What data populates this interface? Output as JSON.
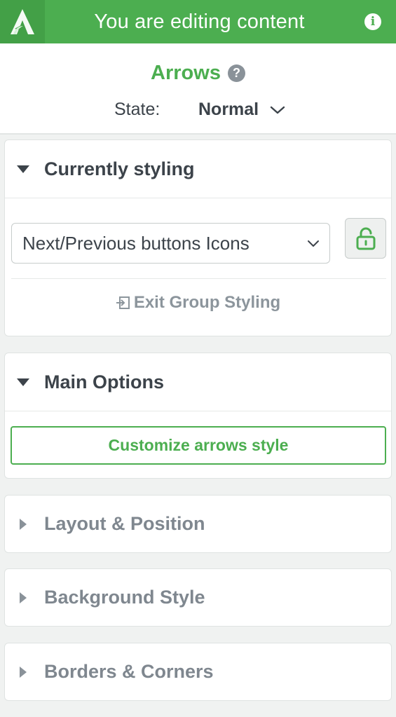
{
  "topbar": {
    "title": "You are editing content",
    "info_glyph": "i",
    "logo": "oxygen-logo-icon",
    "color": "#4cae50"
  },
  "header": {
    "element_title": "Arrows",
    "help_glyph": "?",
    "state_label": "State:",
    "state_value": "Normal"
  },
  "currently_styling": {
    "title": "Currently styling",
    "select_value": "Next/Previous buttons Icons",
    "exit_label": "Exit Group Styling"
  },
  "main_options": {
    "title": "Main Options",
    "customize_label": "Customize arrows style"
  },
  "sections": [
    {
      "title": "Layout & Position"
    },
    {
      "title": "Background Style"
    },
    {
      "title": "Borders & Corners"
    }
  ],
  "colors": {
    "accent": "#4cae50",
    "muted": "#7f878f",
    "text": "#3c434a"
  }
}
